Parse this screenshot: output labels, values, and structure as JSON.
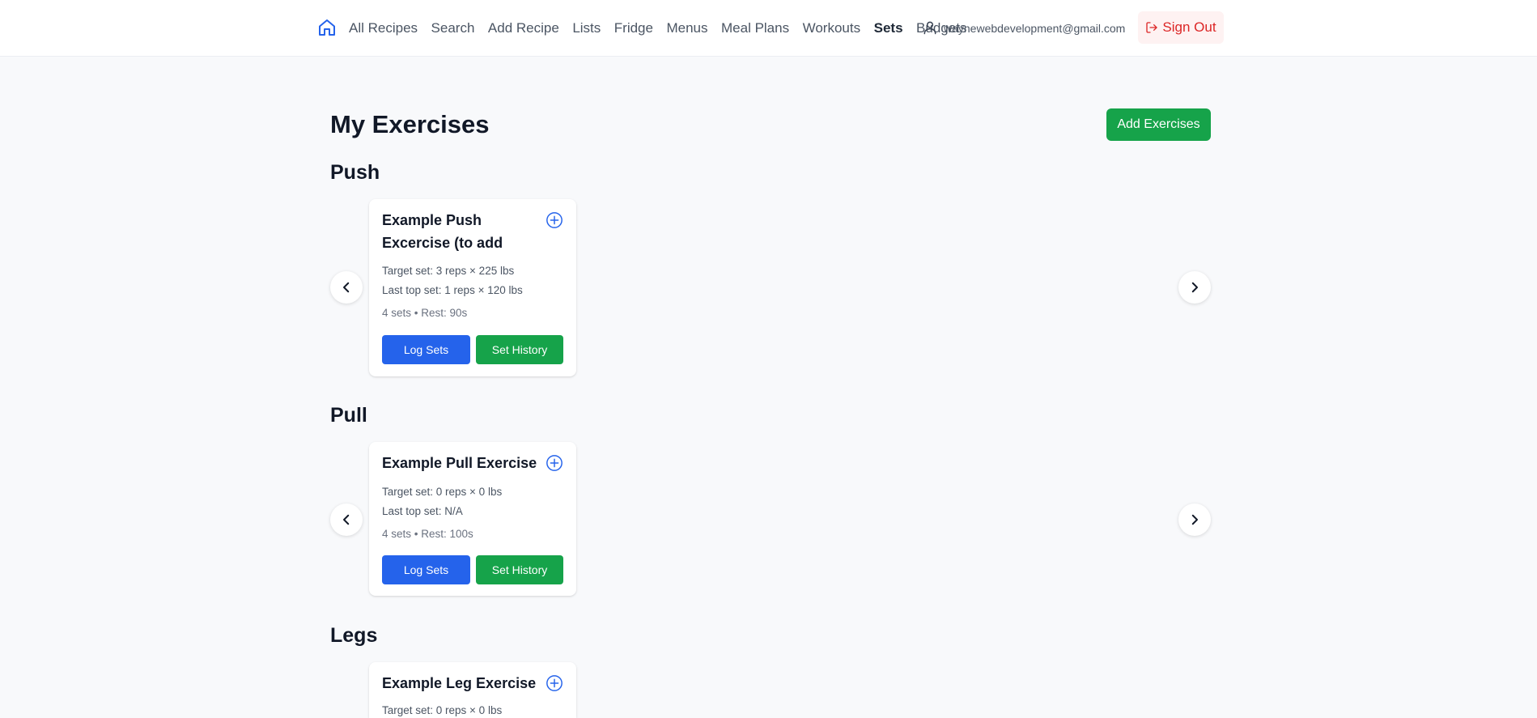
{
  "nav": {
    "home_icon": "home-icon",
    "links": [
      "All Recipes",
      "Search",
      "Add Recipe",
      "Lists",
      "Fridge",
      "Menus",
      "Meal Plans",
      "Workouts",
      "Sets",
      "Budgets"
    ],
    "active_link": "Sets",
    "user_icon": "user-icon",
    "email": "waynewebdevelopment@gmail.com",
    "sign_out": "Sign Out",
    "sign_out_icon": "logout-icon"
  },
  "page": {
    "title": "My Exercises",
    "add_button": "Add Exercises"
  },
  "categories": [
    {
      "name": "Push",
      "card": {
        "title": "Example Push Excercise (to add Target Weight",
        "target": "Target set: 3 reps × 225 lbs",
        "last": "Last top set: 1 reps × 120 lbs",
        "meta": "4 sets • Rest: 90s",
        "log_label": "Log Sets",
        "history_label": "Set History"
      }
    },
    {
      "name": "Pull",
      "card": {
        "title": "Example Pull Exercise",
        "target": "Target set: 0 reps × 0 lbs",
        "last": "Last top set: N/A",
        "meta": "4 sets • Rest: 100s",
        "log_label": "Log Sets",
        "history_label": "Set History"
      }
    },
    {
      "name": "Legs",
      "card": {
        "title": "Example Leg Exercise",
        "target": "Target set: 0 reps × 0 lbs"
      }
    }
  ],
  "colors": {
    "primary_blue": "#2563eb",
    "primary_green": "#16a34a",
    "danger": "#dc2626",
    "page_bg": "#f8f9fb"
  }
}
